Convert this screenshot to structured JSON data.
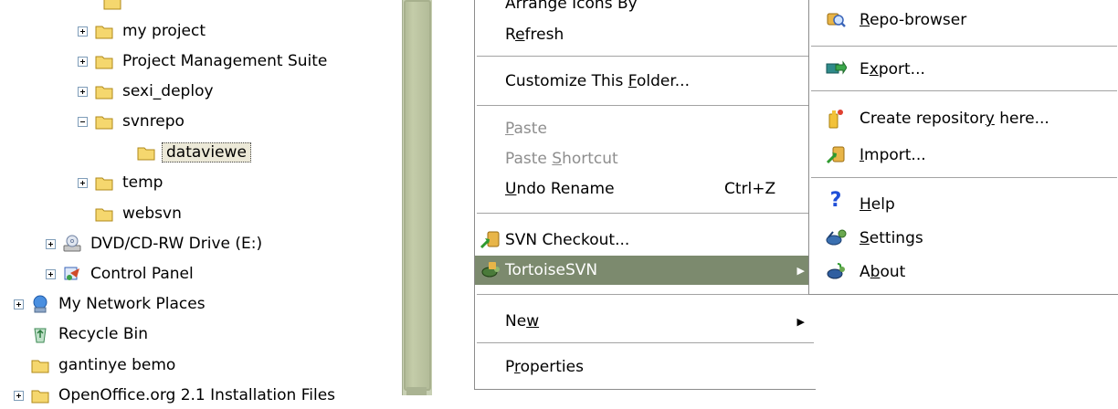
{
  "tree": {
    "items": [
      {
        "label": "my project",
        "expander": "plus"
      },
      {
        "label": "Project Management Suite",
        "expander": "plus"
      },
      {
        "label": "sexi_deploy",
        "expander": "plus"
      },
      {
        "label": "svnrepo",
        "expander": "minus"
      },
      {
        "label": "dataviewe",
        "expander": "none"
      },
      {
        "label": "temp",
        "expander": "plus"
      },
      {
        "label": "websvn",
        "expander": "none"
      },
      {
        "label": "DVD/CD-RW Drive (E:)",
        "expander": "plus"
      },
      {
        "label": "Control Panel",
        "expander": "plus"
      },
      {
        "label": "My Network Places",
        "expander": "plus"
      },
      {
        "label": "Recycle Bin",
        "expander": "none"
      },
      {
        "label": "gantinye bemo",
        "expander": "none"
      },
      {
        "label": "OpenOffice.org 2.1 Installation Files",
        "expander": "plus"
      }
    ]
  },
  "context_menu": {
    "arrange_icons_partial": "Arrange Icons By",
    "refresh": {
      "pre": "R",
      "key": "e",
      "post": "fresh"
    },
    "customize": {
      "pre": "Customize This ",
      "key": "F",
      "post": "older..."
    },
    "paste": {
      "pre": "",
      "key": "P",
      "post": "aste"
    },
    "paste_shortcut": {
      "pre": "Paste ",
      "key": "S",
      "post": "hortcut"
    },
    "undo_rename": {
      "pre": "",
      "key": "U",
      "post": "ndo Rename"
    },
    "undo_shortcut": "Ctrl+Z",
    "svn_checkout": "SVN Checkout...",
    "tortoisesvn": "TortoiseSVN",
    "new": {
      "pre": "Ne",
      "key": "w",
      "post": ""
    },
    "properties": {
      "pre": "P",
      "key": "r",
      "post": "operties"
    },
    "submenu_arrow": "▶"
  },
  "sub_menu": {
    "repo_browser": {
      "pre": "",
      "key": "R",
      "post": "epo-browser"
    },
    "export": {
      "pre": "E",
      "key": "x",
      "post": "port..."
    },
    "create_repo": {
      "pre": "Create repositor",
      "key": "y",
      "post": " here..."
    },
    "import": {
      "pre": "",
      "key": "I",
      "post": "mport..."
    },
    "help_glyph": "?",
    "help": {
      "pre": "",
      "key": "H",
      "post": "elp"
    },
    "settings": {
      "pre": "",
      "key": "S",
      "post": "ettings"
    },
    "about": {
      "pre": "A",
      "key": "b",
      "post": "out"
    }
  },
  "colors": {
    "folder": "#f5d76e",
    "highlight": "#7c8a6e",
    "scrollbar": "#c8d0b4",
    "disabled_text": "#8e8e8e"
  }
}
